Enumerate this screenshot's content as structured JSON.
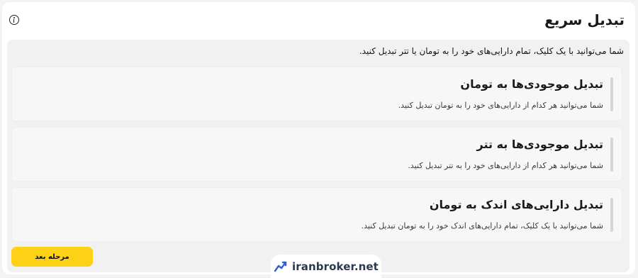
{
  "header": {
    "title": "تبدیل سریع",
    "info_icon": "info-icon"
  },
  "intro_text": "شما می‌توانید با یک کلیک، تمام دارایی‌های خود را به تومان یا تتر تبدیل کنید.",
  "options": [
    {
      "title": "تبدیل موجودی‌ها به تومان",
      "description": "شما می‌توانید هر کدام از دارایی‌های خود را به تومان تبدیل کنید."
    },
    {
      "title": "تبدیل موجودی‌ها به تتر",
      "description": "شما می‌توانید هر کدام از دارایی‌های خود را به تتر تبدیل کنید."
    },
    {
      "title": "تبدیل دارایی‌های اندک به تومان",
      "description": "شما می‌توانید با یک کلیک، تمام دارایی‌های اندک خود را به تومان تبدیل کنید."
    }
  ],
  "next_button_label": "مرحله بعد",
  "watermark": {
    "text": "iranbroker.net",
    "icon": "trend-chart-icon"
  },
  "colors": {
    "accent": "#fcd116",
    "panel_background": "#f1f1f1",
    "option_background": "#f7f7f7",
    "watermark_icon": "#2f5fd6"
  }
}
